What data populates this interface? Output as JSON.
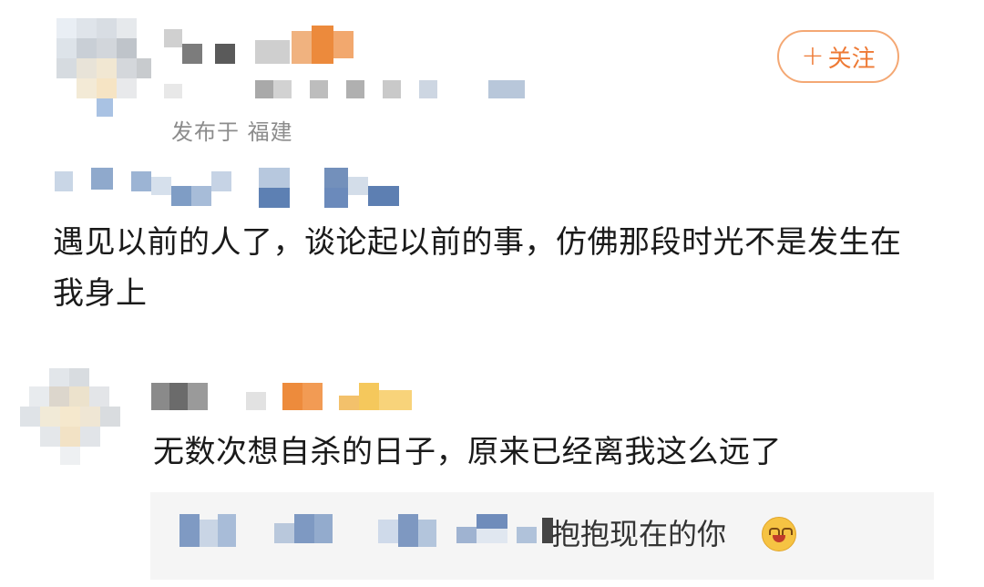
{
  "post": {
    "location": "发布于 福建",
    "follow_label": "关注",
    "follow_plus": "+",
    "text": "遇见以前的人了，谈论起以前的事，仿佛那段时光不是发生在我身上"
  },
  "reply": {
    "text": "无数次想自杀的日子，原来已经离我这么远了",
    "subreply": {
      "text": "抱抱现在的你",
      "emoji": "hug-emoji"
    }
  },
  "colors": {
    "accent": "#ee7a35",
    "follow_border": "#f4a874",
    "muted": "#8c8c8c",
    "subreply_bg": "#f5f5f5"
  }
}
